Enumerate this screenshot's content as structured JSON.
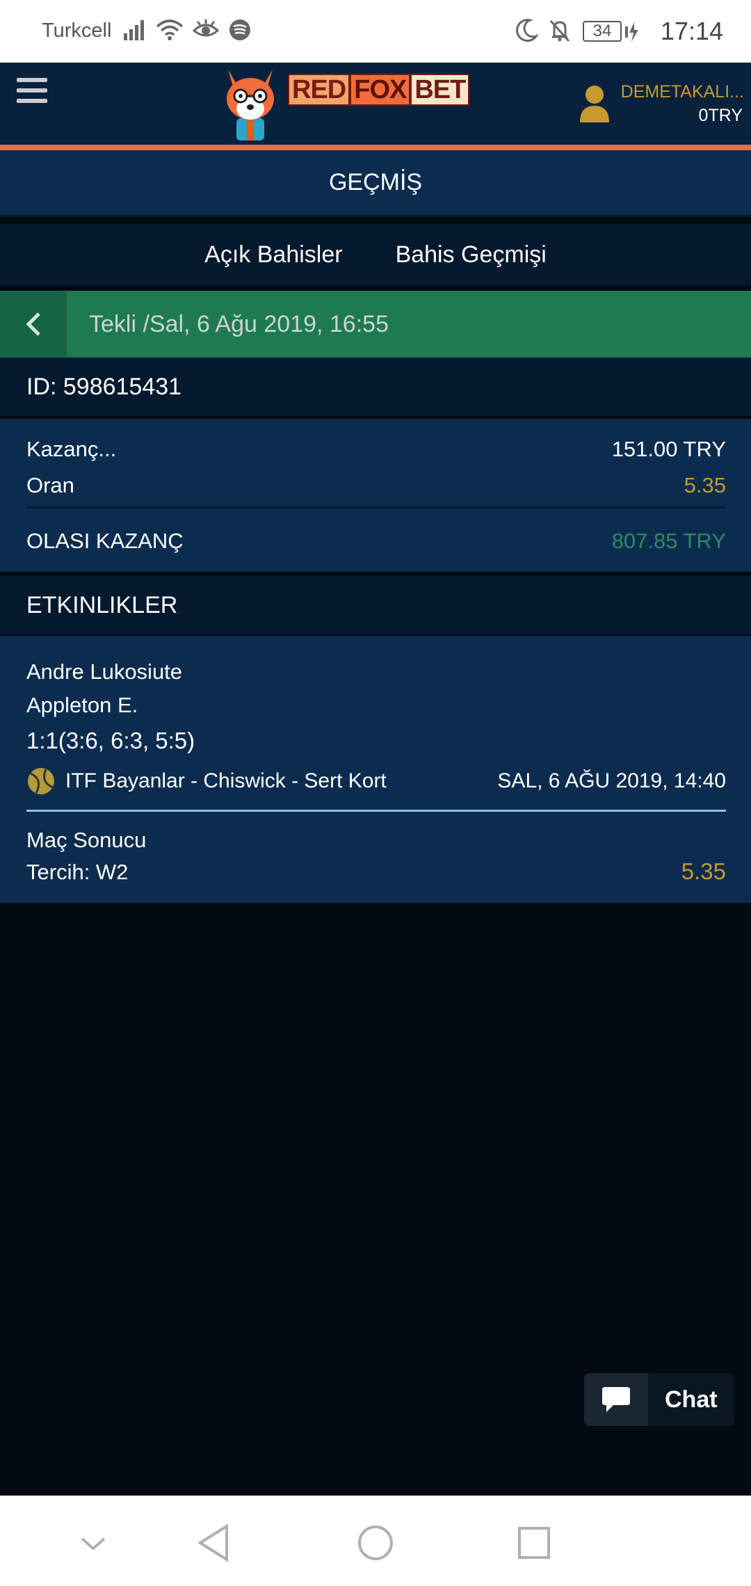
{
  "status_bar": {
    "carrier": "Turkcell",
    "battery": "34",
    "time": "17:14"
  },
  "header": {
    "logo_words": [
      "RED",
      "FOX",
      "BET"
    ],
    "user_name": "DEMETAKALI...",
    "balance": "0TRY"
  },
  "page": {
    "title": "GEÇMİŞ",
    "tabs": [
      "Açık Bahisler",
      "Bahis Geçmişi"
    ]
  },
  "bet": {
    "header": "Tekli /Sal, 6 Ağu 2019, 16:55",
    "id": "ID: 598615431",
    "stake_label": "Kazanç...",
    "stake_value": "151.00 TRY",
    "odds_label": "Oran",
    "odds_value": "5.35",
    "potential_label": "OLASI KAZANÇ",
    "potential_value": "807.85 TRY"
  },
  "events": {
    "section_title": "ETKINLIKLER",
    "items": [
      {
        "team1": "Andre Lukosiute",
        "team2": "Appleton E.",
        "score": "1:1(3:6, 6:3, 5:5)",
        "league": "ITF Bayanlar - Chiswick - Sert Kort",
        "datetime": "SAL, 6 AĞU 2019, 14:40",
        "market": "Maç Sonucu",
        "selection": "Tercih: W2",
        "odds": "5.35"
      }
    ]
  },
  "chat": {
    "label": "Chat"
  },
  "colors": {
    "header_bg": "#08213d",
    "accent_orange": "#f26b3a",
    "green_header": "#1f7a52",
    "gold": "#c89a2e",
    "green_value": "#2e8a5e"
  }
}
